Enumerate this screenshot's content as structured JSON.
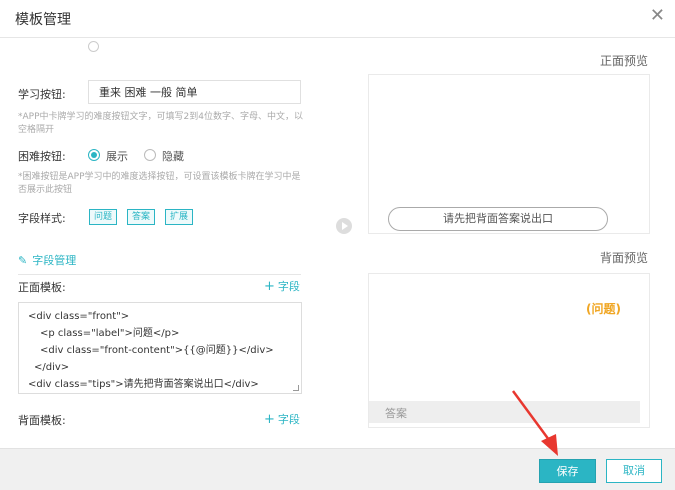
{
  "dialog": {
    "title": "模板管理"
  },
  "form": {
    "study_buttons": {
      "label": "学习按钮:",
      "value": "重来 困难 一般 简单",
      "hint": "*APP中卡牌学习的难度按钮文字，可填写2到4位数字、字母、中文，以空格隔开"
    },
    "hard_button": {
      "label": "困难按钮:",
      "options": [
        "展示",
        "隐藏"
      ],
      "selected": "展示",
      "hint": "*困难按钮是APP学习中的难度选择按钮，可设置该模板卡牌在学习中是否展示此按钮"
    },
    "field_style": {
      "label": "字段样式:",
      "tags": [
        "问题",
        "答案",
        "扩展"
      ]
    },
    "field_manage": {
      "label": "字段管理"
    },
    "front_template": {
      "label": "正面模板:",
      "add_label": "字段",
      "code_lines": [
        "<div class=\"front\">",
        "<p class=\"label\">问题</p>",
        "<div class=\"front-content\">{{@问题}}</div>",
        "</div>",
        "<div class=\"tips\">请先把背面答案说出口</div>"
      ]
    },
    "back_template": {
      "label": "背面模板:",
      "add_label": "字段"
    }
  },
  "preview": {
    "front_title": "正面预览",
    "front_prompt": "请先把背面答案说出口",
    "back_title": "背面预览",
    "back_question": "(问题)",
    "back_answer": "答案"
  },
  "footer": {
    "save": "保存",
    "cancel": "取消"
  },
  "colors": {
    "accent": "#2bb5c4",
    "question": "#f0a623",
    "arrow": "#e8372f"
  }
}
